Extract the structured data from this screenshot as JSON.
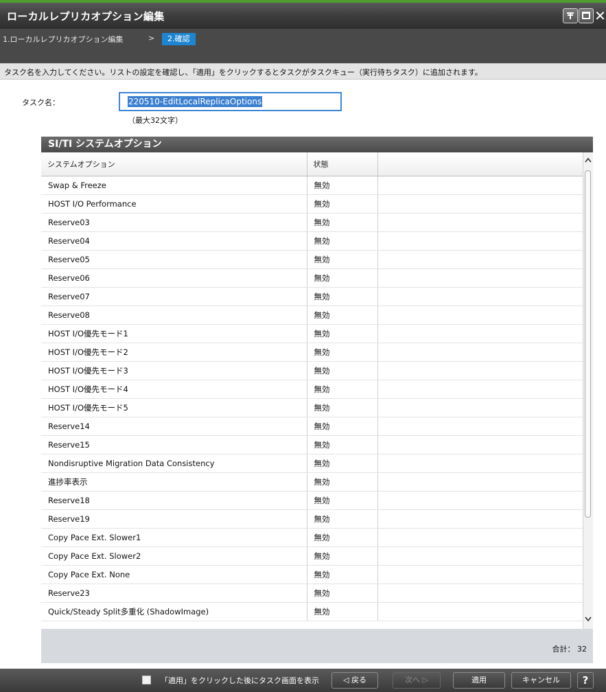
{
  "window": {
    "title": "ローカルレプリカオプション編集",
    "pin_icon": "pin-icon",
    "max_icon": "maximize-icon",
    "close_icon": "close-icon",
    "close_glyph": "✕",
    "accent_color": "#4f9e2f"
  },
  "wizard": {
    "step1": "1.ローカルレプリカオプション編集",
    "separator": ">",
    "step2": "2.確認"
  },
  "instruction": "タスク名を入力してください。リストの設定を確認し、「適用」をクリックするとタスクがタスクキュー（実行待ちタスク）に追加されます。",
  "task": {
    "label": "タスク名：",
    "value": "220510-EditLocalReplicaOptions",
    "hint": "（最大32文字）"
  },
  "panel": {
    "title": "SI/TI システムオプション",
    "columns": [
      "システムオプション",
      "状態",
      ""
    ],
    "rows": [
      [
        "Swap & Freeze",
        "無効"
      ],
      [
        "HOST I/O Performance",
        "無効"
      ],
      [
        "Reserve03",
        "無効"
      ],
      [
        "Reserve04",
        "無効"
      ],
      [
        "Reserve05",
        "無効"
      ],
      [
        "Reserve06",
        "無効"
      ],
      [
        "Reserve07",
        "無効"
      ],
      [
        "Reserve08",
        "無効"
      ],
      [
        "HOST I/O優先モード1",
        "無効"
      ],
      [
        "HOST I/O優先モード2",
        "無効"
      ],
      [
        "HOST I/O優先モード3",
        "無効"
      ],
      [
        "HOST I/O優先モード4",
        "無効"
      ],
      [
        "HOST I/O優先モード5",
        "無効"
      ],
      [
        "Reserve14",
        "無効"
      ],
      [
        "Reserve15",
        "無効"
      ],
      [
        "Nondisruptive Migration Data Consistency",
        "無効"
      ],
      [
        "進捗率表示",
        "無効"
      ],
      [
        "Reserve18",
        "無効"
      ],
      [
        "Reserve19",
        "無効"
      ],
      [
        "Copy Pace Ext. Slower1",
        "無効"
      ],
      [
        "Copy Pace Ext. Slower2",
        "無効"
      ],
      [
        "Copy Pace Ext. None",
        "無効"
      ],
      [
        "Reserve23",
        "無効"
      ],
      [
        "Quick/Steady Split多重化 (ShadowImage)",
        "無効"
      ]
    ],
    "total_label": "合計：",
    "total_value": "32"
  },
  "footer": {
    "checkbox_label": "「適用」をクリックした後にタスク画面を表示",
    "back": "◁ 戻る",
    "next": "次へ ▷",
    "apply": "適用",
    "cancel": "キャンセル",
    "help": "?"
  }
}
